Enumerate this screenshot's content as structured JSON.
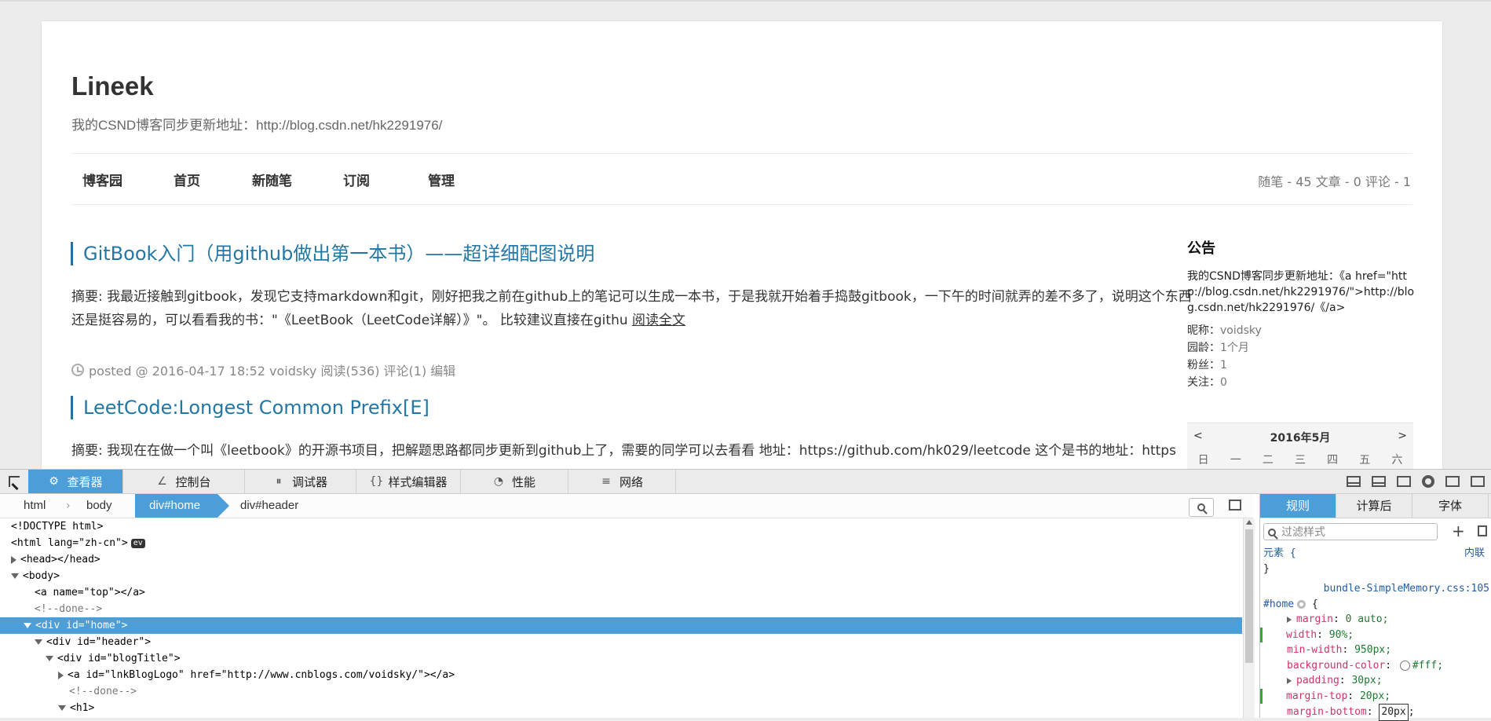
{
  "page": {
    "blog_title": "Lineek",
    "blog_subtitle": "我的CSND博客同步更新地址：http://blog.csdn.net/hk2291976/",
    "nav": [
      "博客园",
      "首页",
      "新随笔",
      "订阅",
      "管理"
    ],
    "stats": "随笔 - 45  文章 - 0  评论 - 1",
    "posts": [
      {
        "title": "GitBook入门（用github做出第一本书）——超详细配图说明",
        "summary": "摘要: 我最近接触到gitbook，发现它支持markdown和git，刚好把我之前在github上的笔记可以生成一本书，于是我就开始着手捣鼓gitbook，一下午的时间就弄的差不多了，说明这个东西还是挺容易的，可以看看我的书：\"《LeetBook（LeetCode详解）》\"。 比较建议直接在githu ",
        "read_more": "阅读全文",
        "meta": "posted @ 2016-04-17 18:52 voidsky 阅读(536) 评论(1) 编辑"
      },
      {
        "title": "LeetCode:Longest Common Prefix[E]",
        "summary": "摘要: 我现在在做一个叫《leetbook》的开源书项目，把解题思路都同步更新到github上了，需要的同学可以去看看 地址：https://github.com/hk029/leetcode 这个是书的地址：https"
      }
    ],
    "sidebar": {
      "title": "公告",
      "notice": "我的CSND博客同步更新地址：《a href=\"http://blog.csdn.net/hk2291976/\">http://blog.csdn.net/hk2291976/《/a>",
      "rows": [
        {
          "label": "昵称：",
          "value": "voidsky"
        },
        {
          "label": "园龄：",
          "value": "1个月"
        },
        {
          "label": "粉丝：",
          "value": "1"
        },
        {
          "label": "关注：",
          "value": "0"
        }
      ],
      "calendar": {
        "prev": "<",
        "month": "2016年5月",
        "next": ">",
        "weekdays": [
          "日",
          "一",
          "二",
          "三",
          "四",
          "五",
          "六"
        ]
      }
    }
  },
  "devtools": {
    "tabs": [
      {
        "label": "查看器",
        "icon": "⚙"
      },
      {
        "label": "控制台",
        "icon": "∠"
      },
      {
        "label": "调试器",
        "icon": "⏸"
      },
      {
        "label": "样式编辑器",
        "icon": "{}"
      },
      {
        "label": "性能",
        "icon": "◔"
      },
      {
        "label": "网络",
        "icon": "≡"
      }
    ],
    "breadcrumb": [
      "html",
      "body",
      "div#home",
      "div#header"
    ],
    "markup": [
      "<!DOCTYPE html>",
      "<html lang=\"zh-cn\">",
      "<head></head>",
      "<body>",
      "<a name=\"top\"></a>",
      "<!--done-->",
      "<div id=\"home\">",
      "<div id=\"header\">",
      "<div id=\"blogTitle\">",
      "<a id=\"lnkBlogLogo\" href=\"http://www.cnblogs.com/voidsky/\"></a>",
      "<!--done-->",
      "<h1>"
    ],
    "ev_badge": "ev",
    "rules_tabs": [
      "规则",
      "计算后",
      "字体"
    ],
    "filter_placeholder": "过滤样式",
    "rules": {
      "element_selector": "元素 {",
      "element_close": "}",
      "inline": "内联",
      "source": "bundle-SimpleMemory.css:105",
      "home_selector": "#home",
      "open_brace": "{",
      "props": [
        {
          "name": "margin",
          "value": "0 auto;"
        },
        {
          "name": "width",
          "value": "90%;"
        },
        {
          "name": "min-width",
          "value": "950px;"
        },
        {
          "name": "background-color",
          "value": "#fff;"
        },
        {
          "name": "padding",
          "value": "30px;"
        },
        {
          "name": "margin-top",
          "value": "20px;"
        },
        {
          "name": "margin-bottom",
          "value": "20px"
        }
      ]
    }
  }
}
